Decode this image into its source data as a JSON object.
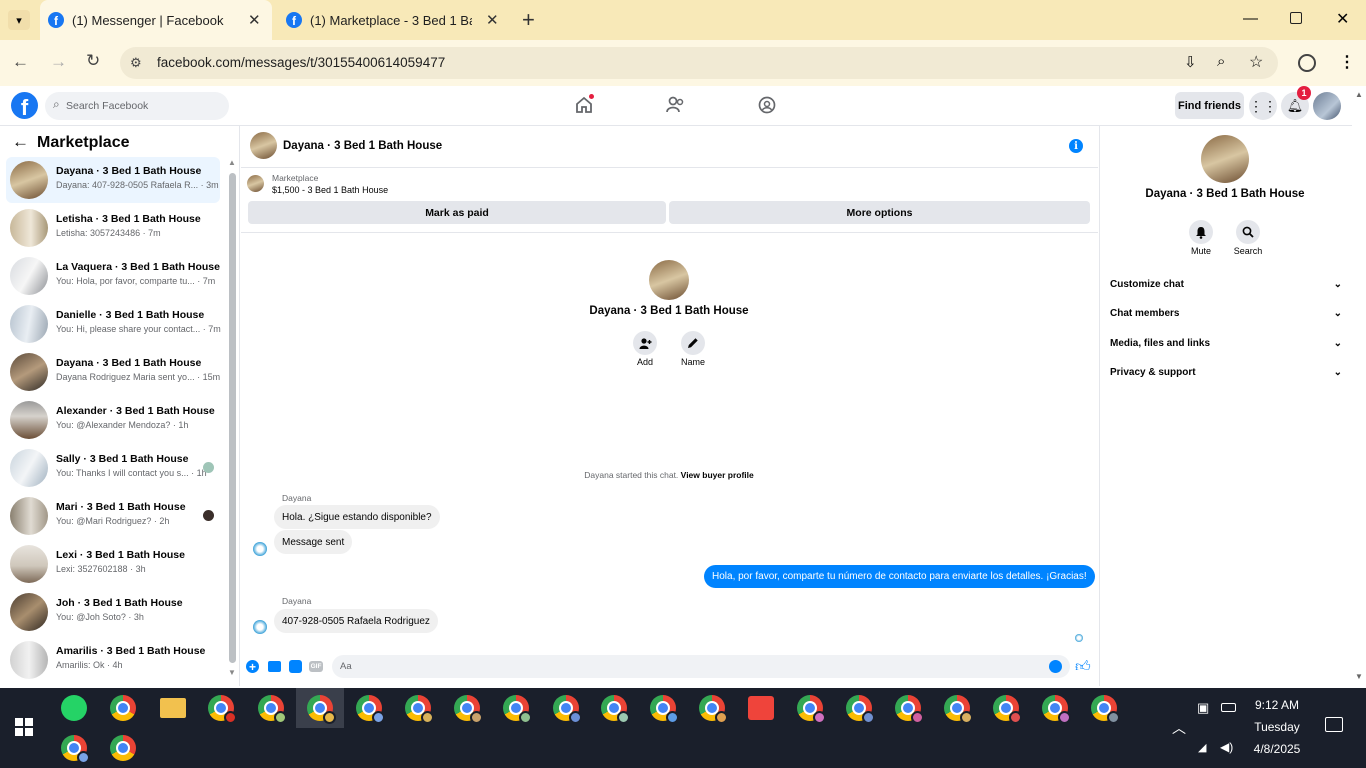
{
  "browser": {
    "tabs": [
      {
        "title": "(1) Messenger | Facebook"
      },
      {
        "title": "(1) Marketplace - 3 Bed 1 Bath"
      }
    ],
    "new_tab": "+",
    "url": "facebook.com/messages/t/30155400614059477"
  },
  "fb": {
    "search_placeholder": "Search Facebook",
    "find_friends": "Find friends",
    "notif_count": "1"
  },
  "left": {
    "title": "Marketplace",
    "conversations": [
      {
        "name": "Dayana · 3 Bed 1 Bath House",
        "preview": "Dayana: 407-928-0505 Rafaela R... · 3m"
      },
      {
        "name": "Letisha · 3 Bed 1 Bath House",
        "preview": "Letisha: 3057243486 · 7m"
      },
      {
        "name": "La Vaquera · 3 Bed 1 Bath House",
        "preview": "You: Hola, por favor, comparte tu... · 7m"
      },
      {
        "name": "Danielle · 3 Bed 1 Bath House",
        "preview": "You: Hi, please share your contact... · 7m"
      },
      {
        "name": "Dayana · 3 Bed 1 Bath House",
        "preview": "Dayana Rodriguez Maria sent yo... · 15m"
      },
      {
        "name": "Alexander · 3 Bed 1 Bath House",
        "preview": "You: @Alexander Mendoza? · 1h"
      },
      {
        "name": "Sally · 3 Bed 1 Bath House",
        "preview": "You: Thanks I will contact you s... · 1h"
      },
      {
        "name": "Mari · 3 Bed 1 Bath House",
        "preview": "You: @Mari Rodriguez? · 2h"
      },
      {
        "name": "Lexi · 3 Bed 1 Bath House",
        "preview": "Lexi: 3527602188 · 3h"
      },
      {
        "name": "Joh · 3 Bed 1 Bath House",
        "preview": "You: @Joh Soto? · 3h"
      },
      {
        "name": "Amarilis · 3 Bed 1 Bath House",
        "preview": "Amarilis: Ok · 4h"
      }
    ]
  },
  "chat": {
    "title": "Dayana · 3 Bed 1 Bath House",
    "listing_label": "Marketplace",
    "listing_title": "$1,500 - 3 Bed 1 Bath House",
    "mark_paid": "Mark as paid",
    "more_options": "More options",
    "center_name": "Dayana · 3 Bed 1 Bath House",
    "add_label": "Add",
    "name_label": "Name",
    "started_text": "Dayana started this chat.",
    "view_profile": "View buyer profile",
    "sender1": "Dayana",
    "msg1": "Hola. ¿Sigue estando disponible?",
    "msg2": "Message sent",
    "my_msg": "Hola, por favor, comparte tu número de contacto para enviarte los detalles. ¡Gracias!",
    "sender2": "Dayana",
    "msg3": "407-928-0505 Rafaela Rodriguez",
    "composer_placeholder": "Aa"
  },
  "right": {
    "name": "Dayana · 3 Bed 1 Bath House",
    "mute": "Mute",
    "search": "Search",
    "sections": [
      "Customize chat",
      "Chat members",
      "Media, files and links",
      "Privacy & support"
    ]
  },
  "taskbar": {
    "time": "9:12 AM",
    "day": "Tuesday",
    "date": "4/8/2025"
  },
  "colors": {
    "facebook_blue": "#1877f2",
    "messenger_blue": "#0084ff",
    "tabbar": "#f8e9b8"
  }
}
